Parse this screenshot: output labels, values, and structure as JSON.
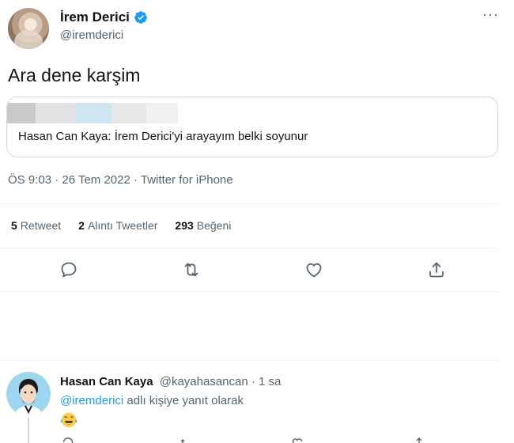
{
  "tweet": {
    "author_name": "İrem Derici",
    "author_handle": "@iremderici",
    "more_label": "···",
    "text": "Ara dene karşim",
    "quote_text": "Hasan Can Kaya: İrem Derici'yi arayayım belki soyunur",
    "timestamp": "ÖS 9:03 · 26 Tem 2022 · Twitter for iPhone",
    "stats": {
      "retweets_count": "5",
      "retweets_label": "Retweet",
      "quotes_count": "2",
      "quotes_label": "Alıntı Tweetler",
      "likes_count": "293",
      "likes_label": "Beğeni"
    },
    "actions": [
      "reply-icon",
      "retweet-icon",
      "like-icon",
      "share-icon"
    ],
    "colors": {
      "verified": "#1d9bf0",
      "secondary_text": "#536471",
      "divider": "#eff3f4"
    }
  },
  "reply": {
    "author_name": "Hasan Can Kaya",
    "meta": "@kayahasancan · 1 sa",
    "mention": "@iremderici",
    "reply_suffix": "adlı kişiye yanıt olarak",
    "emoji": "face-with-tears-of-joy"
  }
}
